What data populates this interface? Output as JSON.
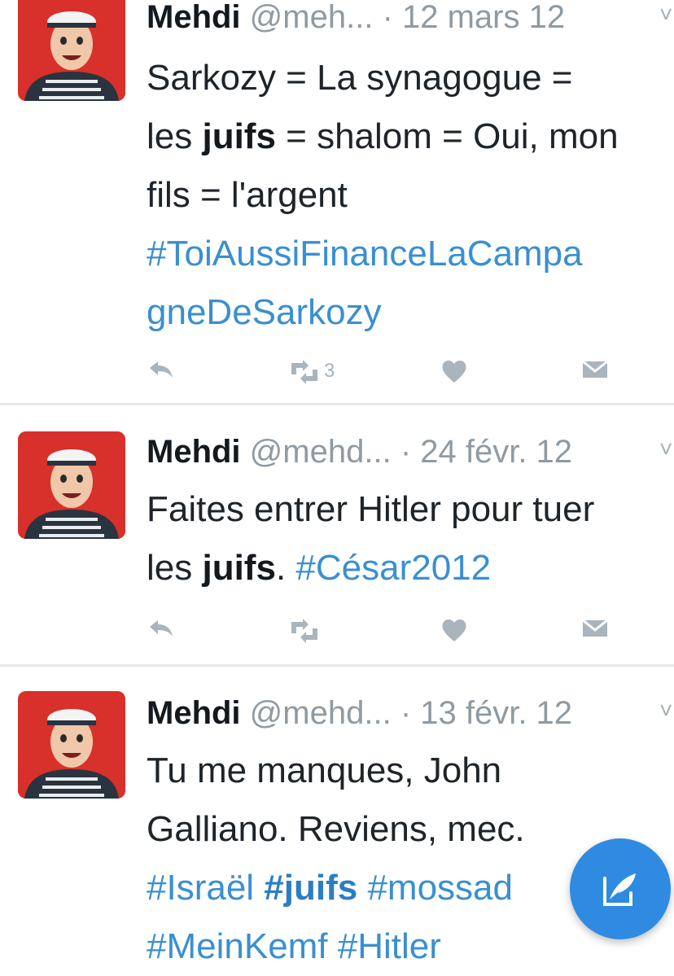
{
  "tweets": [
    {
      "name": "Mehdi",
      "handle": "@meh...",
      "date": "· 12 mars 12",
      "lines": [
        [
          "Sarkozy = La synagogue ="
        ],
        [
          "les ",
          {
            "b": "juifs"
          },
          " = shalom = Oui, mon"
        ],
        [
          "fils = l'argent"
        ],
        [
          {
            "h": "#ToiAussiFinanceLaCampa"
          }
        ],
        [
          {
            "h": "gneDeSarkozy"
          }
        ]
      ],
      "retweet_count": "3"
    },
    {
      "name": "Mehdi",
      "handle": "@mehd...",
      "date": "· 24 févr. 12",
      "lines": [
        [
          "Faites entrer Hitler pour tuer"
        ],
        [
          "les ",
          {
            "b": "juifs"
          },
          ". ",
          {
            "h": "#César2012"
          }
        ]
      ],
      "retweet_count": ""
    },
    {
      "name": "Mehdi",
      "handle": "@mehd...",
      "date": "· 13 févr. 12",
      "lines": [
        [
          "Tu me manques, John"
        ],
        [
          "Galliano. Reviens, mec."
        ],
        [
          {
            "h": "#Israël "
          },
          {
            "hb": "#juifs"
          },
          {
            "h": " #mossad"
          }
        ],
        [
          {
            "h": "#MeinKemf #Hitler"
          }
        ]
      ],
      "retweet_count": ""
    }
  ],
  "icons": {
    "reply": "reply-icon",
    "retweet": "retweet-icon",
    "like": "heart-icon",
    "message": "direct-message-icon",
    "compose": "compose-tweet-icon"
  },
  "colors": {
    "hashtag": "#3a8fd0",
    "meta": "#8f9aa3",
    "fab": "#2e8be1",
    "avatar_bg": "#d8302a"
  }
}
